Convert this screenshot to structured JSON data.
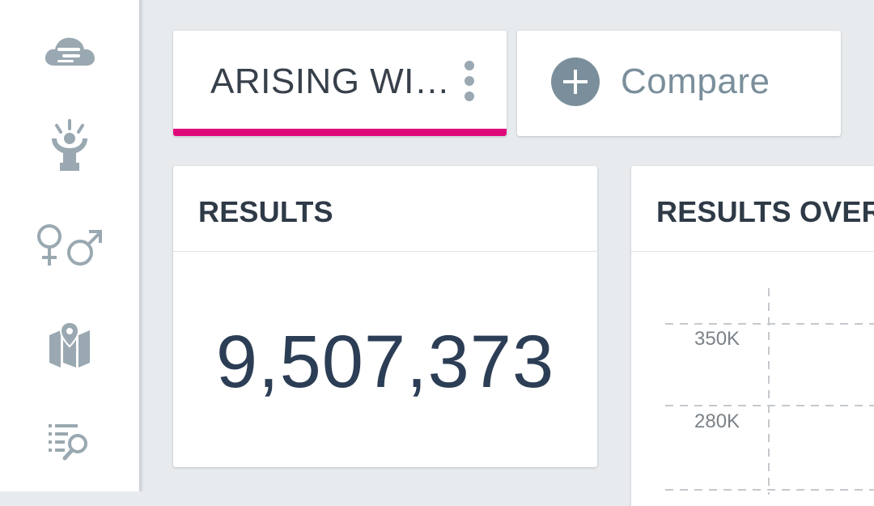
{
  "sidebar": {
    "items": [
      {
        "icon": "cloud-icon"
      },
      {
        "icon": "person-highlight-icon"
      },
      {
        "icon": "gender-icon"
      },
      {
        "icon": "map-pin-icon"
      },
      {
        "icon": "list-search-icon"
      }
    ],
    "icon_color": "#9aa8b1"
  },
  "tabs": {
    "active": {
      "label": "ARISING WI…",
      "accent": "#e0097a"
    },
    "compare": {
      "label": "Compare",
      "color": "#7a8f9b"
    }
  },
  "results_card": {
    "title": "RESULTS",
    "value": "9,507,373"
  },
  "results_over_card": {
    "title": "RESULTS OVER",
    "chart_data": {
      "type": "line",
      "title": "RESULTS OVER",
      "y_tick_labels": [
        "350K",
        "280K"
      ],
      "y_ticks": [
        350000,
        280000
      ],
      "grid": true
    }
  }
}
